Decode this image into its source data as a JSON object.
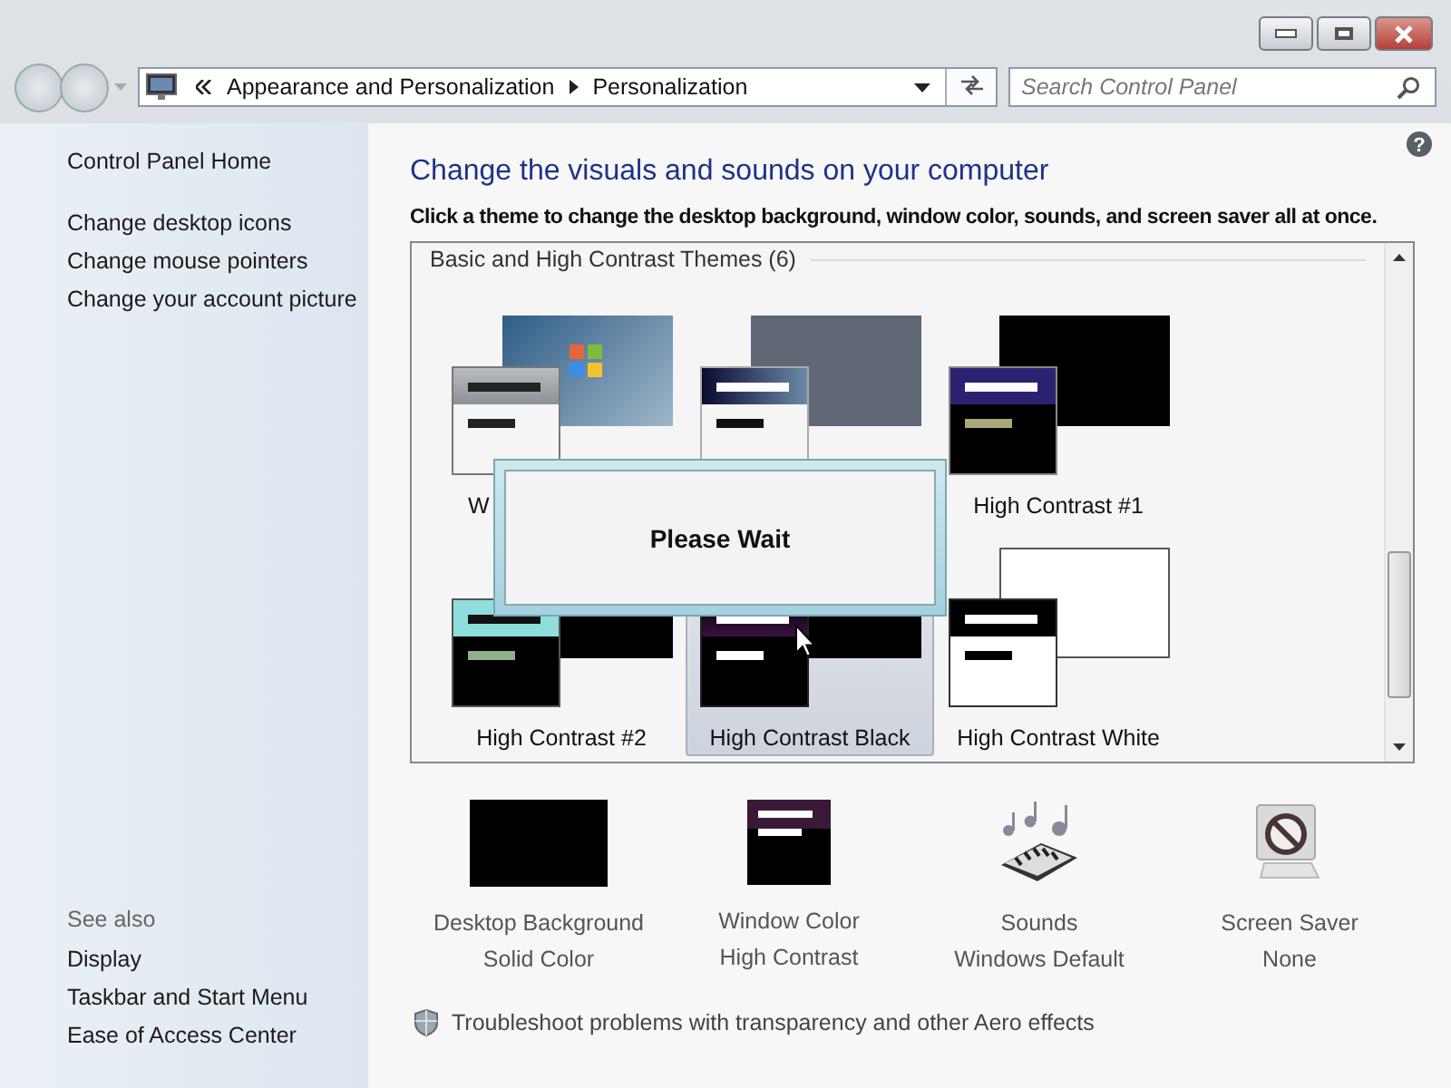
{
  "address": {
    "segments": [
      "Appearance and Personalization",
      "Personalization"
    ],
    "search_placeholder": "Search Control Panel"
  },
  "sidebar": {
    "home": "Control Panel Home",
    "links": [
      "Change desktop icons",
      "Change mouse pointers",
      "Change your account picture"
    ],
    "see_also": {
      "heading": "See also",
      "links": [
        "Display",
        "Taskbar and Start Menu",
        "Ease of Access Center"
      ]
    }
  },
  "help": "?",
  "main": {
    "title": "Change the visuals and sounds on your computer",
    "description": "Click a theme to change the desktop background, window color, sounds, and screen saver all at once."
  },
  "themes": {
    "group_title": "Basic and High Contrast Themes (6)",
    "items": [
      {
        "kind": "basic",
        "label": "W",
        "selected": false
      },
      {
        "kind": "classic",
        "selected": false
      },
      {
        "kind": "hc1",
        "label": "High Contrast #1",
        "selected": false
      },
      {
        "kind": "hc2",
        "label": "High Contrast #2",
        "selected": false
      },
      {
        "kind": "hcblack",
        "label": "High Contrast Black",
        "selected": true
      },
      {
        "kind": "hcwhite",
        "label": "High Contrast White",
        "selected": false
      }
    ]
  },
  "dialog": {
    "message": "Please Wait"
  },
  "settings": [
    {
      "kind": "background",
      "title": "Desktop Background",
      "value": "Solid Color"
    },
    {
      "kind": "window",
      "title": "Window Color",
      "value": "High Contrast"
    },
    {
      "kind": "sounds",
      "title": "Sounds",
      "value": "Windows Default"
    },
    {
      "kind": "saver",
      "title": "Screen Saver",
      "value": "None"
    }
  ],
  "troubleshoot": "Troubleshoot problems with transparency and other Aero effects"
}
